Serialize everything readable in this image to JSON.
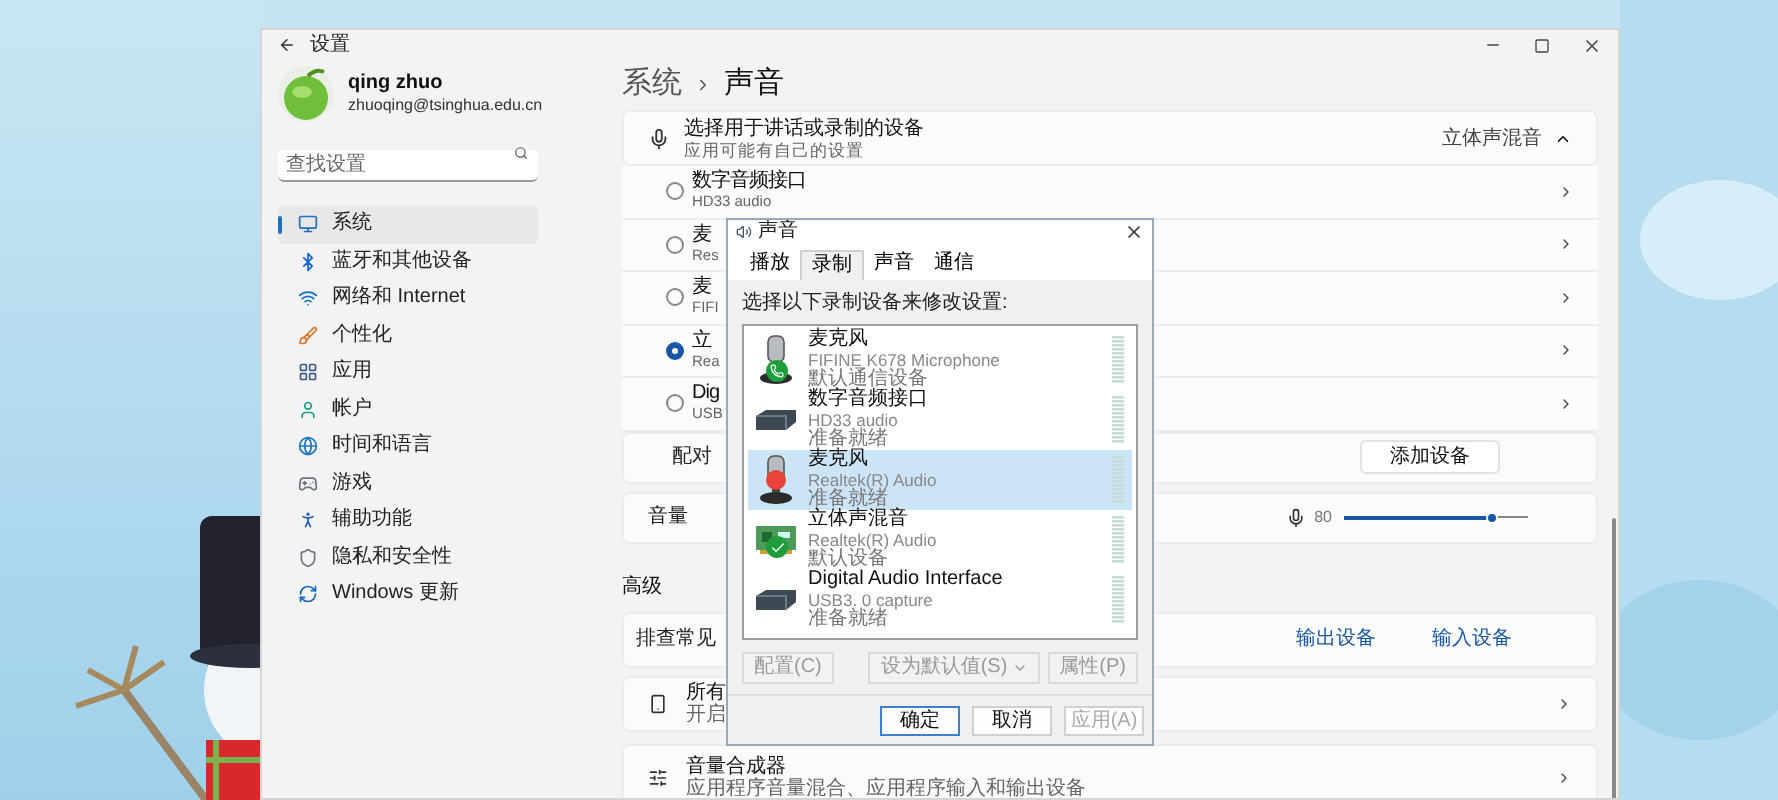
{
  "window": {
    "title": "设置"
  },
  "user": {
    "name": "qing zhuo",
    "email": "zhuoqing@tsinghua.edu.cn"
  },
  "search": {
    "placeholder": "查找设置"
  },
  "sidebar": {
    "items": [
      {
        "label": "系统",
        "selected": true
      },
      {
        "label": "蓝牙和其他设备",
        "selected": false
      },
      {
        "label": "网络和 Internet",
        "selected": false
      },
      {
        "label": "个性化",
        "selected": false
      },
      {
        "label": "应用",
        "selected": false
      },
      {
        "label": "帐户",
        "selected": false
      },
      {
        "label": "时间和语言",
        "selected": false
      },
      {
        "label": "游戏",
        "selected": false
      },
      {
        "label": "辅助功能",
        "selected": false
      },
      {
        "label": "隐私和安全性",
        "selected": false
      },
      {
        "label": "Windows 更新",
        "selected": false
      }
    ]
  },
  "breadcrumb": [
    "系统",
    "声音"
  ],
  "input_section": {
    "title": "选择用于讲话或录制的设备",
    "subtitle": "应用可能有自己的设置",
    "value": "立体声混音",
    "expanded": true,
    "devices": [
      {
        "name": "数字音频接口",
        "detail": "HD33 audio",
        "selected": false
      },
      {
        "name": "麦",
        "detail": "Res",
        "selected": false
      },
      {
        "name": "麦",
        "detail": "FIFI",
        "selected": false
      },
      {
        "name": "立",
        "detail": "Rea",
        "selected": true
      },
      {
        "name": "Dig",
        "detail": "USB",
        "selected": false
      }
    ],
    "pair_label": "配对",
    "pair_button": "添加设备"
  },
  "volume": {
    "label": "音量",
    "reading": "80",
    "level": 0.8
  },
  "advanced": {
    "heading": "高级",
    "troubleshoot": "排查常见",
    "links": [
      "输出设备",
      "输入设备"
    ],
    "rows": [
      {
        "title": "所有",
        "subtitle": "开启"
      },
      {
        "title": "音量合成器",
        "subtitle": "应用程序音量混合、应用程序输入和输出设备"
      }
    ]
  },
  "dialog": {
    "title": "声音",
    "tabs": [
      {
        "label": "播放",
        "selected": false
      },
      {
        "label": "录制",
        "selected": true
      },
      {
        "label": "声音",
        "selected": false
      },
      {
        "label": "通信",
        "selected": false
      }
    ],
    "prompt": "选择以下录制设备来修改设置:",
    "devices": [
      {
        "kind": "mic",
        "default_comm": true,
        "default": false,
        "stopped": false,
        "name": "麦克风",
        "detail": "FIFINE K678 Microphone",
        "status": "默认通信设备",
        "selected": false
      },
      {
        "kind": "box",
        "default_comm": false,
        "default": false,
        "stopped": false,
        "name": "数字音频接口",
        "detail": "HD33 audio",
        "status": "准备就绪",
        "selected": false
      },
      {
        "kind": "mic",
        "default_comm": false,
        "default": false,
        "stopped": true,
        "name": "麦克风",
        "detail": "Realtek(R) Audio",
        "status": "准备就绪",
        "selected": true
      },
      {
        "kind": "card",
        "default_comm": false,
        "default": true,
        "stopped": false,
        "name": "立体声混音",
        "detail": "Realtek(R) Audio",
        "status": "默认设备",
        "selected": false
      },
      {
        "kind": "box",
        "default_comm": false,
        "default": false,
        "stopped": false,
        "name": "Digital Audio Interface",
        "detail": "USB3. 0 capture",
        "status": "准备就绪",
        "selected": false
      }
    ],
    "buttons": [
      {
        "label": "配置(C)",
        "disabled": true
      },
      {
        "label": "设为默认值(S)",
        "disabled": true
      },
      {
        "label": "属性(P)",
        "disabled": true
      }
    ],
    "footer": [
      {
        "label": "确定",
        "disabled": false,
        "primary": true
      },
      {
        "label": "取消",
        "disabled": false,
        "primary": false
      },
      {
        "label": "应用(A)",
        "disabled": true,
        "primary": false
      }
    ]
  }
}
